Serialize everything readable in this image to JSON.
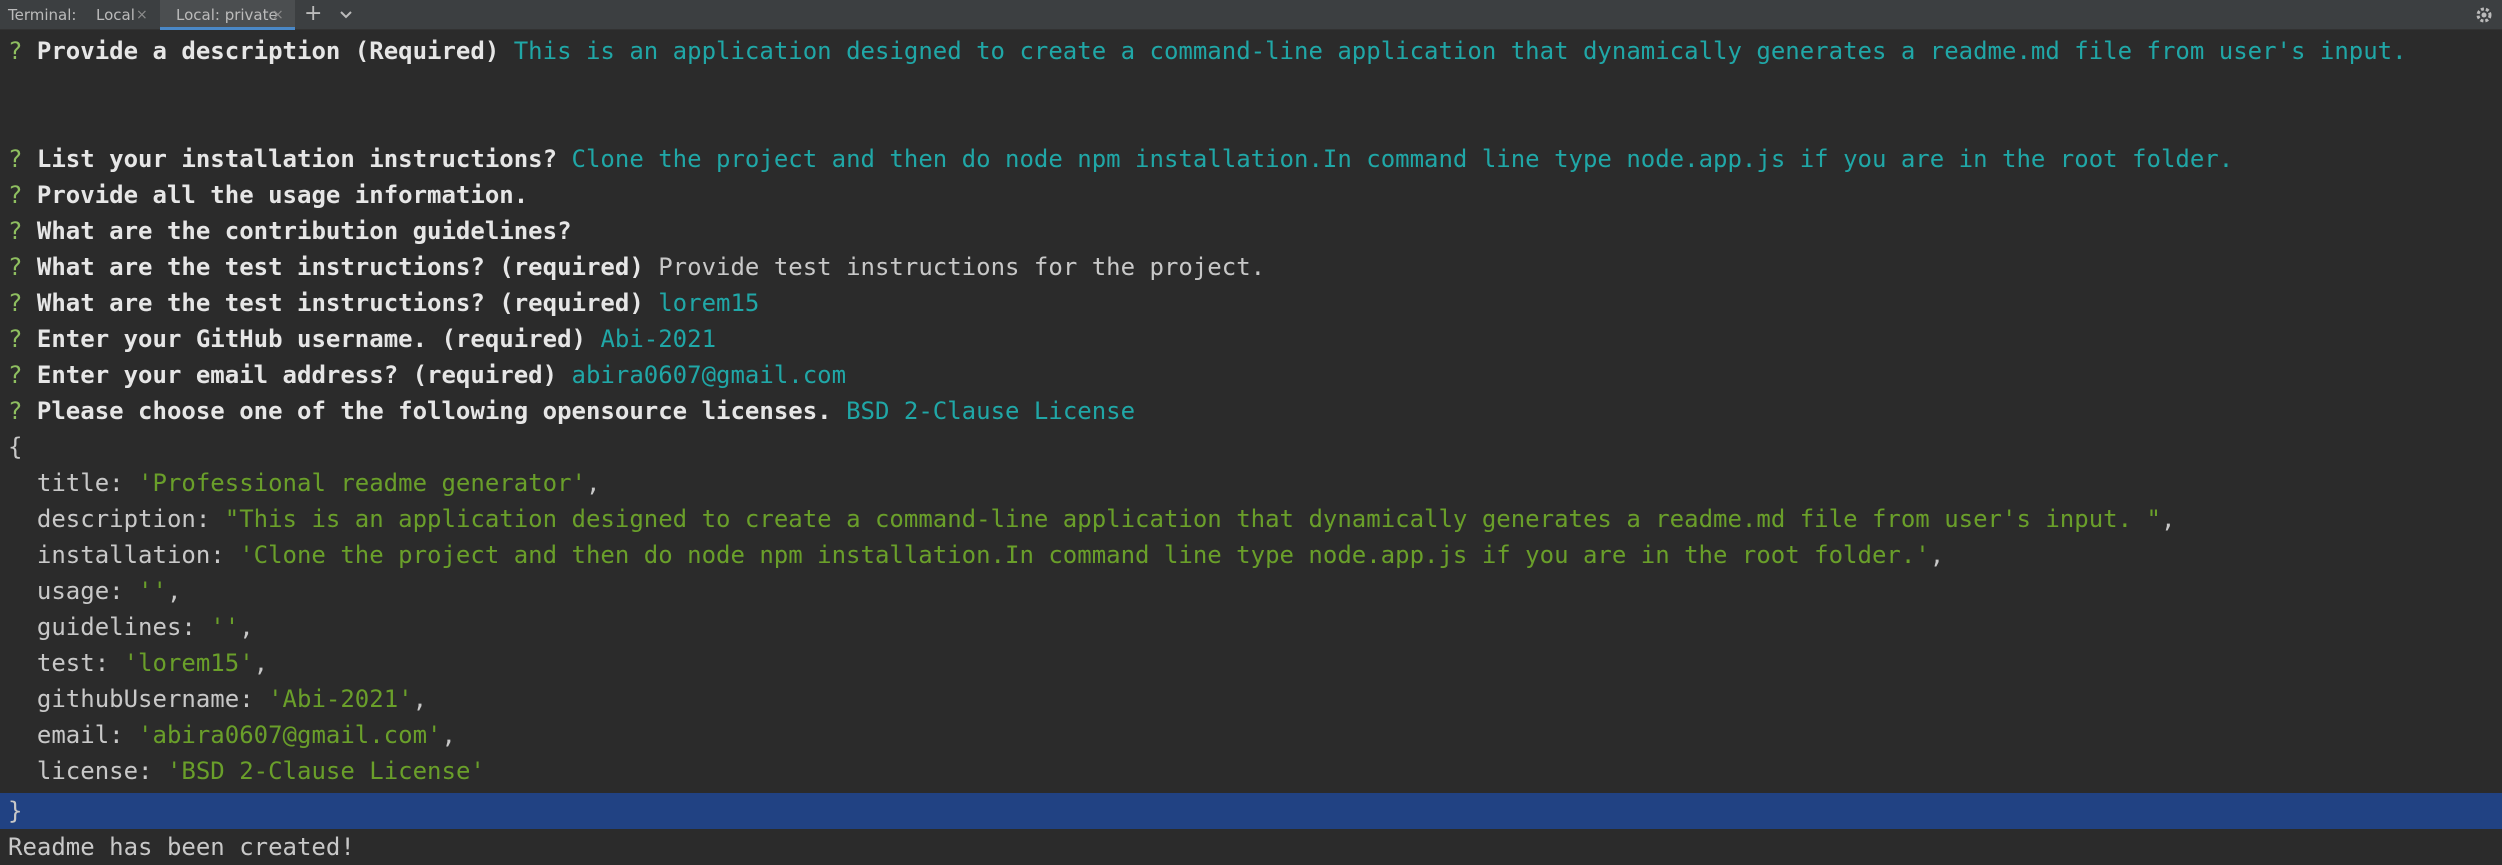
{
  "tabbar": {
    "label": "Terminal:",
    "tabs": [
      {
        "label": "Local"
      },
      {
        "label": "Local: private"
      }
    ],
    "close_glyph": "×",
    "add_glyph": "+"
  },
  "terminal": {
    "qmark": "?",
    "lines": {
      "description": {
        "prompt": "Provide a description (Required)",
        "answer": "This is an application designed to create a command-line application that dynamically generates a readme.md file from user's input."
      },
      "installation": {
        "prompt": "List your installation instructions?",
        "answer": "Clone the project and then do node npm installation.In command line type node.app.js if you are in the root folder."
      },
      "usage": {
        "prompt": "Provide all the usage information."
      },
      "guidelines": {
        "prompt": "What are the contribution guidelines?"
      },
      "test1": {
        "prompt": "What are the test instructions? (required)",
        "answer": "Provide test instructions for the project."
      },
      "test2": {
        "prompt": "What are the test instructions? (required)",
        "answer": "lorem15"
      },
      "github": {
        "prompt": "Enter your GitHub username. (required)",
        "answer": "Abi-2021"
      },
      "email": {
        "prompt": "Enter your email address? (required)",
        "answer": "abira0607@gmail.com"
      },
      "license": {
        "prompt": "Please choose one of the following opensource licenses.",
        "answer": "BSD 2-Clause License"
      }
    },
    "object": {
      "open": "{",
      "close": "}",
      "entries": [
        {
          "key": "  title: ",
          "value": "'Professional readme generator'",
          "suffix": ","
        },
        {
          "key": "  description: ",
          "value": "\"This is an application designed to create a command-line application that dynamically generates a readme.md file from user's input. \"",
          "suffix": ","
        },
        {
          "key": "  installation: ",
          "value": "'Clone the project and then do node npm installation.In command line type node.app.js if you are in the root folder.'",
          "suffix": ","
        },
        {
          "key": "  usage: ",
          "value": "''",
          "suffix": ","
        },
        {
          "key": "  guidelines: ",
          "value": "''",
          "suffix": ","
        },
        {
          "key": "  test: ",
          "value": "'lorem15'",
          "suffix": ","
        },
        {
          "key": "  githubUsername: ",
          "value": "'Abi-2021'",
          "suffix": ","
        },
        {
          "key": "  email: ",
          "value": "'abira0607@gmail.com'",
          "suffix": ","
        },
        {
          "key": "  license: ",
          "value": "'BSD 2-Clause License'",
          "suffix": ""
        }
      ]
    },
    "final_message": "Readme has been created!"
  },
  "colors": {
    "background": "#2b2b2b",
    "answer": "#20a7a7",
    "string_value": "#6a9f2a",
    "selection": "#214283"
  }
}
